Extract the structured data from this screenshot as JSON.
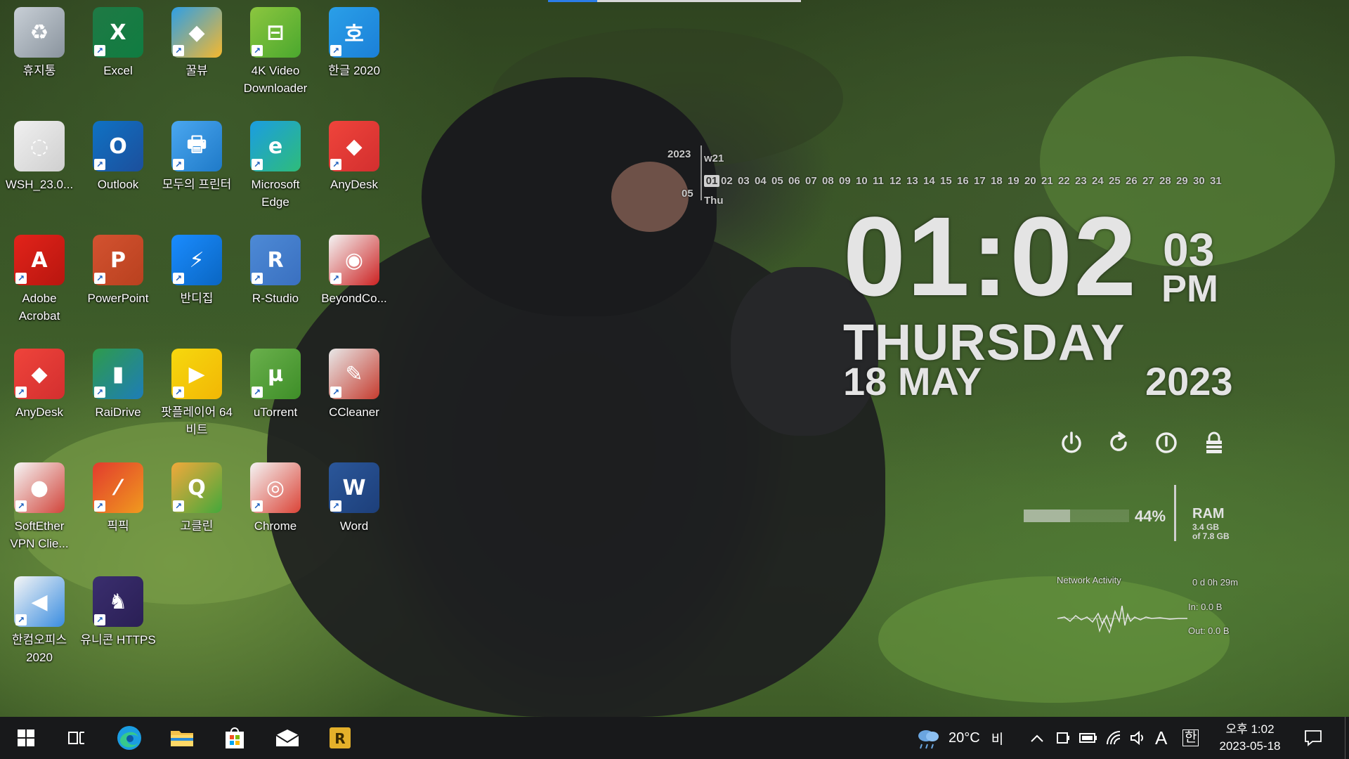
{
  "desktop": {
    "icons": [
      {
        "name": "recycle-bin-icon",
        "label": "휴지통"
      },
      {
        "name": "excel-icon",
        "label": "Excel"
      },
      {
        "name": "kkulview-icon",
        "label": "꿀뷰"
      },
      {
        "name": "4k-video-downloader-icon",
        "label": "4K Video Downloader"
      },
      {
        "name": "hangul-2020-icon",
        "label": "한글 2020"
      },
      {
        "name": "wsh-file-icon",
        "label": "WSH_23.0..."
      },
      {
        "name": "outlook-icon",
        "label": "Outlook"
      },
      {
        "name": "modu-printer-icon",
        "label": "모두의 프린터"
      },
      {
        "name": "edge-icon",
        "label": "Microsoft Edge"
      },
      {
        "name": "anydesk-icon",
        "label": "AnyDesk"
      },
      {
        "name": "adobe-acrobat-icon",
        "label": "Adobe Acrobat"
      },
      {
        "name": "powerpoint-icon",
        "label": "PowerPoint"
      },
      {
        "name": "bandizip-icon",
        "label": "반디집"
      },
      {
        "name": "r-studio-icon",
        "label": "R-Studio"
      },
      {
        "name": "beyond-compare-icon",
        "label": "BeyondCo..."
      },
      {
        "name": "anydesk-icon-2",
        "label": "AnyDesk"
      },
      {
        "name": "raidrive-icon",
        "label": "RaiDrive"
      },
      {
        "name": "potplayer-icon",
        "label": "팟플레이어 64 비트"
      },
      {
        "name": "utorrent-icon",
        "label": "uTorrent"
      },
      {
        "name": "ccleaner-icon",
        "label": "CCleaner"
      },
      {
        "name": "softether-vpn-icon",
        "label": "SoftEther VPN Clie..."
      },
      {
        "name": "picpick-icon",
        "label": "픽픽"
      },
      {
        "name": "goclean-icon",
        "label": "고클린"
      },
      {
        "name": "chrome-icon",
        "label": "Chrome"
      },
      {
        "name": "word-icon",
        "label": "Word"
      },
      {
        "name": "hancom-office-icon",
        "label": "한컴오피스 2020"
      },
      {
        "name": "unicorn-https-icon",
        "label": "유니콘 HTTPS"
      }
    ]
  },
  "calendar": {
    "year": "2023",
    "month": "05",
    "week": "w21",
    "weekday_short": "Thu",
    "days": [
      "01",
      "02",
      "03",
      "04",
      "05",
      "06",
      "07",
      "08",
      "09",
      "10",
      "11",
      "12",
      "13",
      "14",
      "15",
      "16",
      "17",
      "18",
      "19",
      "20",
      "21",
      "22",
      "23",
      "24",
      "25",
      "26",
      "27",
      "28",
      "29",
      "30",
      "31"
    ],
    "today": "01"
  },
  "clock": {
    "time": "01:02",
    "seconds": "03",
    "ampm": "PM",
    "weekday": "THURSDAY",
    "day_month": "18 MAY",
    "year": "2023"
  },
  "ram": {
    "percent_label": "44%",
    "percent": 0.44,
    "title": "RAM",
    "used": "3.4 GB",
    "total": "of 7.8 GB"
  },
  "network": {
    "title": "Network Activity",
    "uptime": "0 d 0h 29m",
    "in": "In: 0.0 B",
    "out": "Out: 0.0 B"
  },
  "taskbar": {
    "weather_temp": "20°C",
    "weather_desc": "비",
    "ime_mode": "A",
    "ime_lang": "한",
    "time": "오후 1:02",
    "date": "2023-05-18"
  },
  "colors": {
    "taskbar_bg": "#18191b",
    "accent": "#2b7de9"
  }
}
